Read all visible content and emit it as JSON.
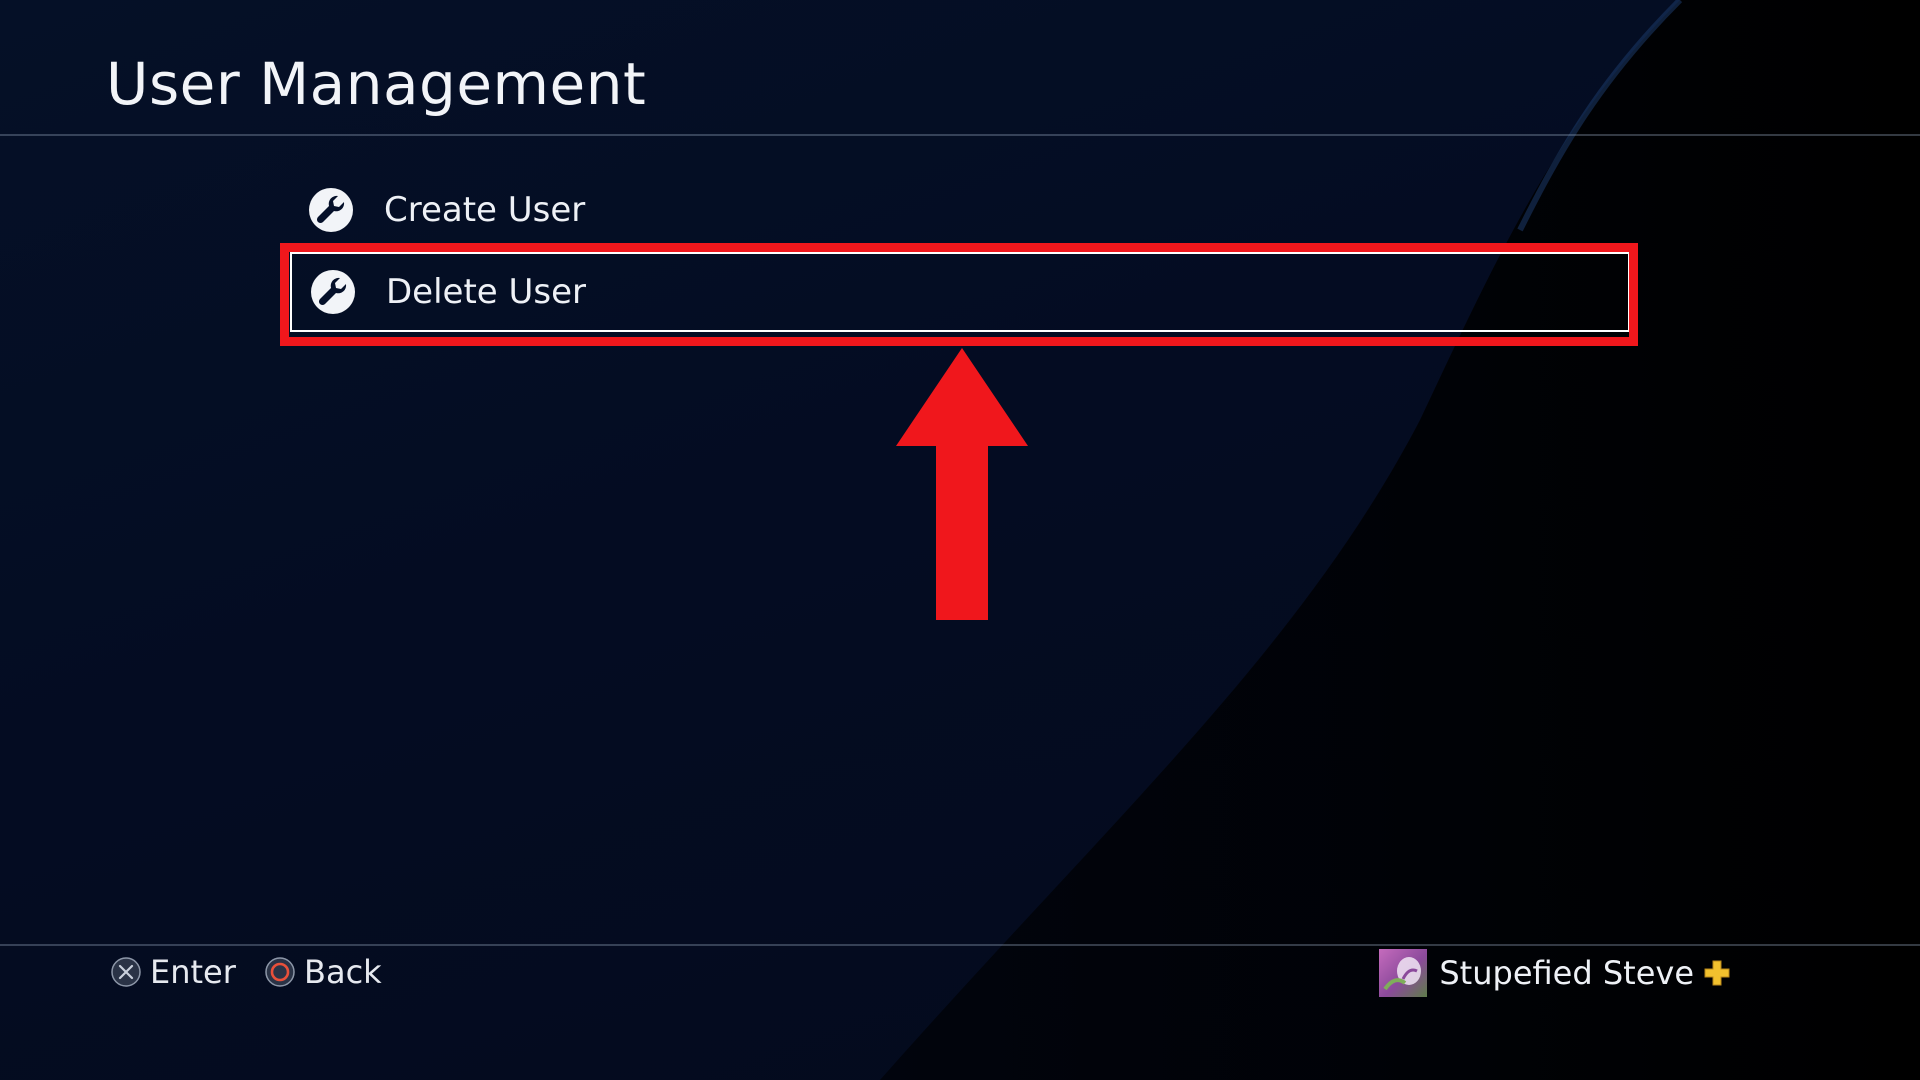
{
  "header": {
    "title": "User Management"
  },
  "menu": {
    "items": [
      {
        "label": "Create User",
        "icon": "wrench-icon"
      },
      {
        "label": "Delete User",
        "icon": "wrench-icon",
        "selected": true
      }
    ]
  },
  "annotation": {
    "highlight_color": "#f0171c",
    "arrow_color": "#f0171c",
    "highlighted_item": "Delete User"
  },
  "footer": {
    "enter_label": "Enter",
    "enter_icon": "cross-button-icon",
    "back_label": "Back",
    "back_icon": "circle-button-icon",
    "user": {
      "name": "Stupefied Steve",
      "plus_icon": "playstation-plus-icon"
    }
  },
  "colors": {
    "background": "#030c20",
    "text": "#eef1f6",
    "circle_button": "#e8503a",
    "plus_gold": "#f2c12e"
  }
}
